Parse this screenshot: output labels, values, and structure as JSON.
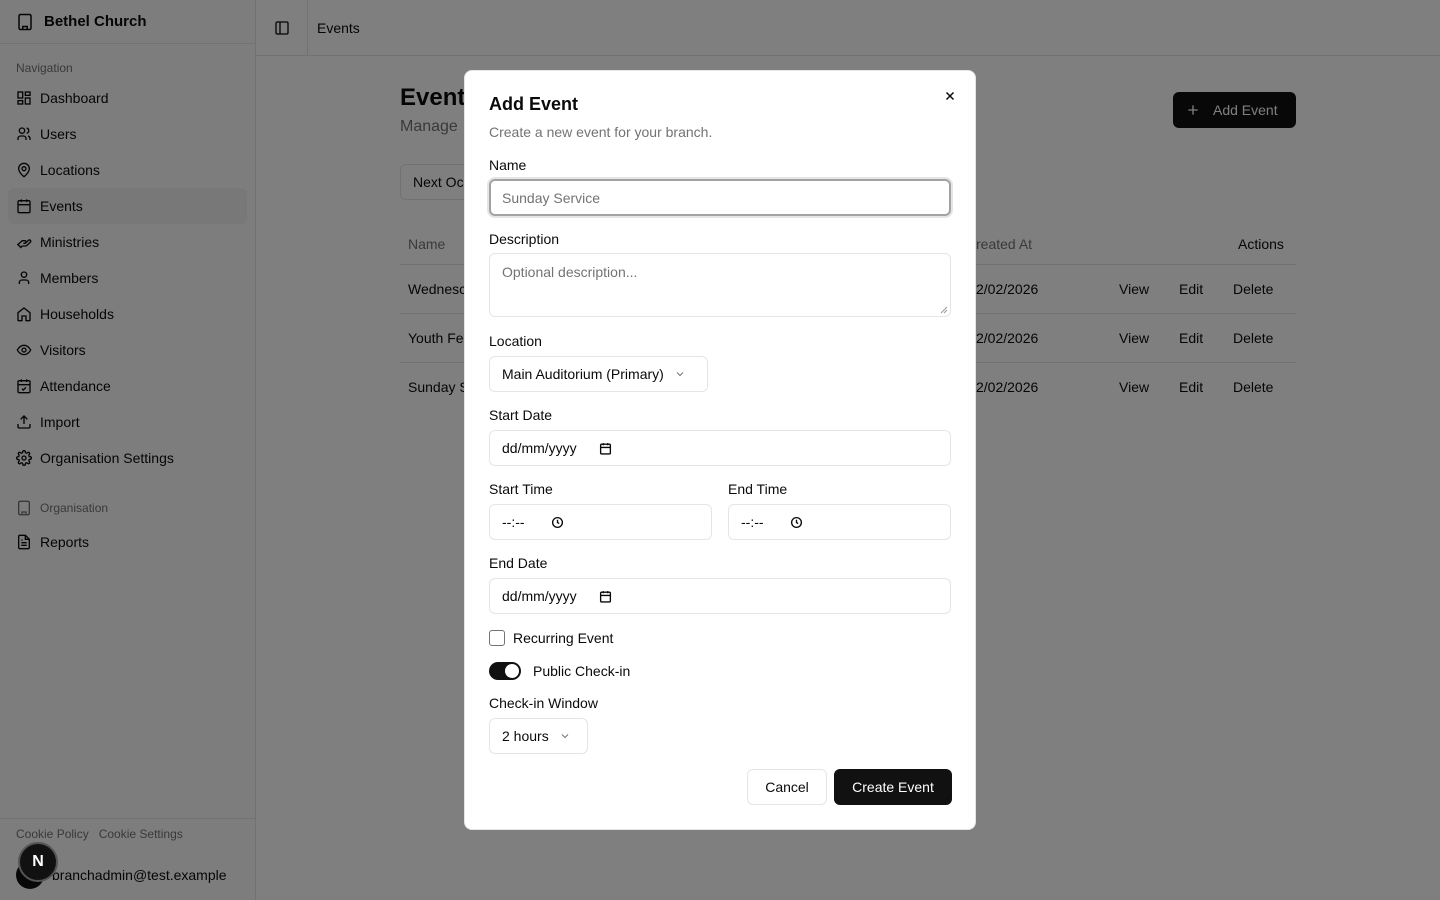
{
  "sidebar": {
    "brand": "Bethel Church",
    "nav_label": "Navigation",
    "items": [
      {
        "label": "Dashboard"
      },
      {
        "label": "Users"
      },
      {
        "label": "Locations"
      },
      {
        "label": "Events"
      },
      {
        "label": "Ministries"
      },
      {
        "label": "Members"
      },
      {
        "label": "Households"
      },
      {
        "label": "Visitors"
      },
      {
        "label": "Attendance"
      },
      {
        "label": "Import"
      },
      {
        "label": "Organisation Settings"
      }
    ],
    "org_label": "Organisation",
    "org_items": [
      {
        "label": "Reports"
      }
    ],
    "cookie_policy": "Cookie Policy",
    "cookie_settings": "Cookie Settings",
    "user_email": "branchadmin@test.example",
    "badge": "N"
  },
  "header": {
    "breadcrumb": "Events"
  },
  "page": {
    "title": "Events",
    "subtitle": "Manage",
    "add_button": "Add Event",
    "filter_label": "Next Oc",
    "table": {
      "headers": {
        "name": "Name",
        "created_at": "reated At",
        "actions": "Actions"
      },
      "rows": [
        {
          "name": "Wednesc",
          "created": "2/02/2026"
        },
        {
          "name": "Youth Fe",
          "created": "2/02/2026"
        },
        {
          "name": "Sunday S",
          "created": "2/02/2026"
        }
      ],
      "actions": {
        "view": "View",
        "edit": "Edit",
        "delete": "Delete"
      }
    }
  },
  "modal": {
    "title": "Add Event",
    "description": "Create a new event for your branch.",
    "name_label": "Name",
    "name_placeholder": "Sunday Service",
    "description_label": "Description",
    "description_placeholder": "Optional description...",
    "location_label": "Location",
    "location_value": "Main Auditorium (Primary)",
    "start_date_label": "Start Date",
    "start_date_value": "dd/mm/yyyy",
    "start_time_label": "Start Time",
    "start_time_value": "--:--",
    "end_time_label": "End Time",
    "end_time_value": "--:--",
    "end_date_label": "End Date",
    "end_date_value": "dd/mm/yyyy",
    "recurring_label": "Recurring Event",
    "recurring_checked": false,
    "public_checkin_label": "Public Check-in",
    "public_checkin_on": true,
    "checkin_window_label": "Check-in Window",
    "checkin_window_value": "2 hours",
    "cancel": "Cancel",
    "create": "Create Event"
  },
  "colors": {
    "primary": "#111111",
    "muted_text": "#737373",
    "border": "#e5e5e5",
    "overlay": "rgba(0,0,0,0.5)"
  }
}
